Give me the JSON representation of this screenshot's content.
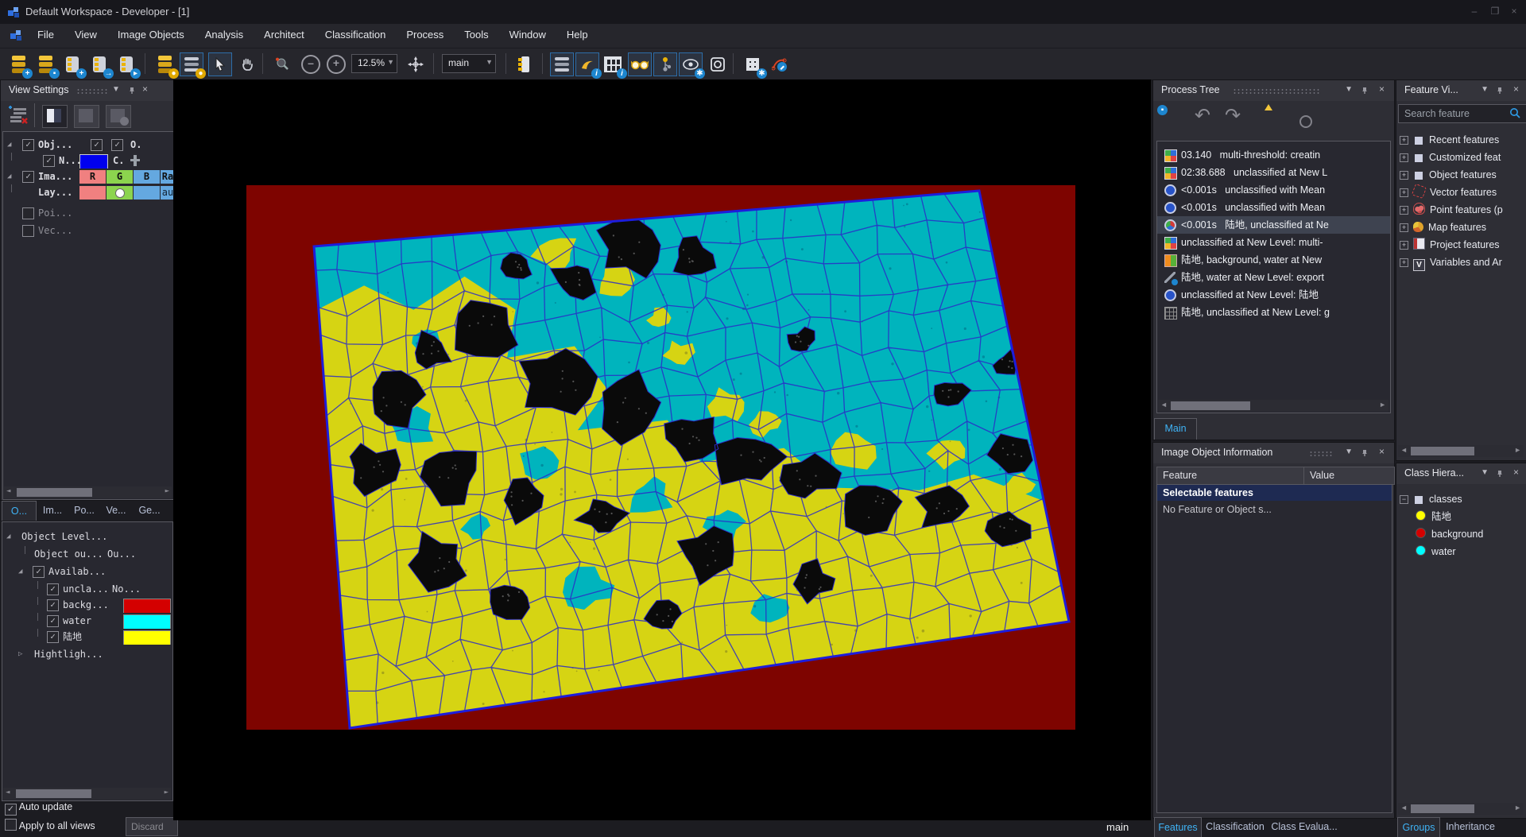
{
  "window": {
    "title": "Default Workspace - Developer - [1]"
  },
  "menu_bar": {
    "items": [
      "File",
      "View",
      "Image Objects",
      "Analysis",
      "Architect",
      "Classification",
      "Process",
      "Tools",
      "Window",
      "Help"
    ]
  },
  "toolbar": {
    "zoom_level": "12.5%",
    "map_select": "main",
    "icons": [
      "create-workspace",
      "save-workspace",
      "add-project",
      "import-scene",
      "open-project",
      "load-scenes-clock",
      "process-history",
      "select-cursor",
      "pan-hand",
      "zoom-select",
      "zoom-out",
      "zoom-in",
      "navigate-pan",
      "split-window",
      "view-layer-list",
      "view-classification",
      "view-side-by-side",
      "show-classification-glasses",
      "image-object-graph",
      "show-pixel-gear",
      "zoom-area",
      "grid-settings",
      "draw-polygon"
    ]
  },
  "view_settings": {
    "title": "View Settings",
    "rows": {
      "obj": {
        "label": "Obj...",
        "col": "O."
      },
      "n": {
        "label": "N...",
        "col": "C.",
        "swatch": "#0000ff"
      },
      "ima": {
        "label": "Ima...",
        "r": "R",
        "g": "G",
        "b": "B",
        "ra": "Ra"
      },
      "lay": {
        "label": "Lay...",
        "col": "au"
      },
      "poi": {
        "label": "Poi..."
      },
      "vec": {
        "label": "Vec..."
      }
    }
  },
  "layer_panel": {
    "tabs": [
      "O...",
      "Im...",
      "Po...",
      "Ve...",
      "Ge..."
    ],
    "active_tab": "O...",
    "tree": {
      "root": "Object Level...",
      "row2": {
        "label": "Object ou...",
        "col": "Ou..."
      },
      "row3": {
        "label": "Availab..."
      },
      "row4": {
        "label": "uncla...",
        "col": "No..."
      },
      "row5": {
        "label": "backg...",
        "color": "#d40000"
      },
      "row6": {
        "label": "water",
        "color": "#00ffff"
      },
      "row7": {
        "label": "陆地",
        "color": "#ffff00"
      },
      "row8": {
        "label": "Hightligh..."
      }
    },
    "auto_update": {
      "label": "Auto update",
      "checked": true
    },
    "apply_all": {
      "label": "Apply to all views",
      "checked": false
    },
    "discard_button": "Discard"
  },
  "viewer": {
    "tab": "main",
    "colors": {
      "background": "#000000",
      "scene_fill": "#7e0400",
      "water": "#00b4bd",
      "land": "#d6d413",
      "outline": "#1d1ddc",
      "mesh": "#2a2ac8",
      "unclassified": "#0a0a0a"
    }
  },
  "process_tree": {
    "title": "Process Tree",
    "tab": "Main",
    "items": [
      {
        "icon": "levels-icon",
        "time": "03.140",
        "text": "multi-threshold: creatin"
      },
      {
        "icon": "levels-icon",
        "time": "02:38.688",
        "text": "unclassified at  New L"
      },
      {
        "icon": "classify-icon",
        "time": "<0.001s",
        "text": "unclassified with Mean"
      },
      {
        "icon": "classify-icon",
        "time": "<0.001s",
        "text": "unclassified with Mean"
      },
      {
        "icon": "classify-color-icon",
        "time": "<0.001s",
        "text": "陆地, unclassified at  Ne",
        "selected": true
      },
      {
        "icon": "levels-icon",
        "time": "",
        "text": "unclassified at  New Level: multi-"
      },
      {
        "icon": "merge-icon",
        "time": "",
        "text": "陆地, background, water at  New"
      },
      {
        "icon": "export-vector-icon",
        "time": "",
        "text": "陆地, water at  New Level: export"
      },
      {
        "icon": "classify-icon",
        "time": "",
        "text": "unclassified at  New Level: 陆地"
      },
      {
        "icon": "grid-move-icon",
        "time": "",
        "text": "陆地, unclassified at  New Level: g"
      }
    ]
  },
  "image_object_info": {
    "title": "Image Object Information",
    "columns": [
      "Feature",
      "Value"
    ],
    "section_row": "Selectable features",
    "empty_row": "No Feature or Object s...",
    "tabs": [
      "Features",
      "Classification",
      "Class Evalua..."
    ],
    "active_tab": "Features"
  },
  "feature_view": {
    "title": "Feature Vi...",
    "search_placeholder": "Search feature",
    "items": [
      {
        "icon": "square-icon",
        "label": "Recent features"
      },
      {
        "icon": "square-icon",
        "label": "Customized feat"
      },
      {
        "icon": "square-icon",
        "label": "Object features"
      },
      {
        "icon": "vector-polygon-icon",
        "label": "Vector features"
      },
      {
        "icon": "point-cloud-icon",
        "label": "Point features (p"
      },
      {
        "icon": "map-icon",
        "label": "Map features"
      },
      {
        "icon": "project-icon",
        "label": "Project features"
      },
      {
        "icon": "variables-icon",
        "label": "Variables and Ar"
      }
    ]
  },
  "class_hierarchy": {
    "title": "Class Hiera...",
    "root": "classes",
    "classes": [
      {
        "name": "陆地",
        "color": "#ffff00"
      },
      {
        "name": "background",
        "color": "#d40000"
      },
      {
        "name": "water",
        "color": "#00ffff"
      }
    ],
    "tabs": [
      "Groups",
      "Inheritance"
    ],
    "active_tab": "Groups"
  }
}
